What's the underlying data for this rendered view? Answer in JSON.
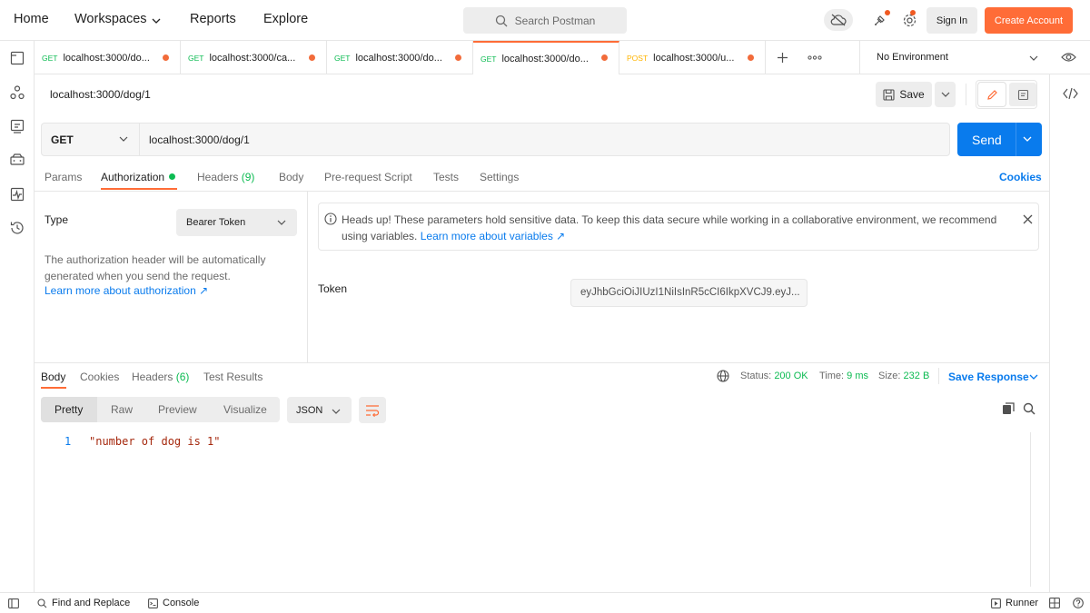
{
  "nav": {
    "home": "Home",
    "workspaces": "Workspaces",
    "reports": "Reports",
    "explore": "Explore",
    "search_placeholder": "Search Postman",
    "sign_in": "Sign In",
    "create_account": "Create Account"
  },
  "tabs": [
    {
      "method": "GET",
      "label": "localhost:3000/do..."
    },
    {
      "method": "GET",
      "label": "localhost:3000/ca..."
    },
    {
      "method": "GET",
      "label": "localhost:3000/do..."
    },
    {
      "method": "GET",
      "label": "localhost:3000/do..."
    },
    {
      "method": "POST",
      "label": "localhost:3000/u..."
    }
  ],
  "environment": "No Environment",
  "request": {
    "title": "localhost:3000/dog/1",
    "save": "Save",
    "method": "GET",
    "url": "localhost:3000/dog/1",
    "send": "Send"
  },
  "req_tabs": {
    "params": "Params",
    "authorization": "Authorization",
    "headers": "Headers",
    "headers_count": "(9)",
    "body": "Body",
    "prerequest": "Pre-request Script",
    "tests": "Tests",
    "settings": "Settings",
    "cookies": "Cookies"
  },
  "auth": {
    "type_label": "Type",
    "type_value": "Bearer Token",
    "description": "The authorization header will be automatically generated when you send the request.",
    "learn_more": "Learn more about authorization ↗",
    "alert_text": "Heads up! These parameters hold sensitive data. To keep this data secure while working in a collaborative environment, we recommend using variables.",
    "alert_link": "Learn more about variables ↗",
    "token_label": "Token",
    "token_value": "eyJhbGciOiJIUzI1NiIsInR5cCI6IkpXVCJ9.eyJ..."
  },
  "response": {
    "body": "Body",
    "cookies": "Cookies",
    "headers": "Headers",
    "headers_count": "(6)",
    "test_results": "Test Results",
    "status_label": "Status:",
    "status_value": "200 OK",
    "time_label": "Time:",
    "time_value": "9 ms",
    "size_label": "Size:",
    "size_value": "232 B",
    "save_response": "Save Response",
    "view_pretty": "Pretty",
    "view_raw": "Raw",
    "view_preview": "Preview",
    "view_visualize": "Visualize",
    "format": "JSON",
    "line_no": "1",
    "line_text": "\"number of dog is 1\""
  },
  "footer": {
    "find_replace": "Find and Replace",
    "console": "Console",
    "runner": "Runner"
  },
  "colors": {
    "accent": "#ff6c37",
    "primary_blue": "#097bed",
    "success_green": "#0cbb52"
  }
}
